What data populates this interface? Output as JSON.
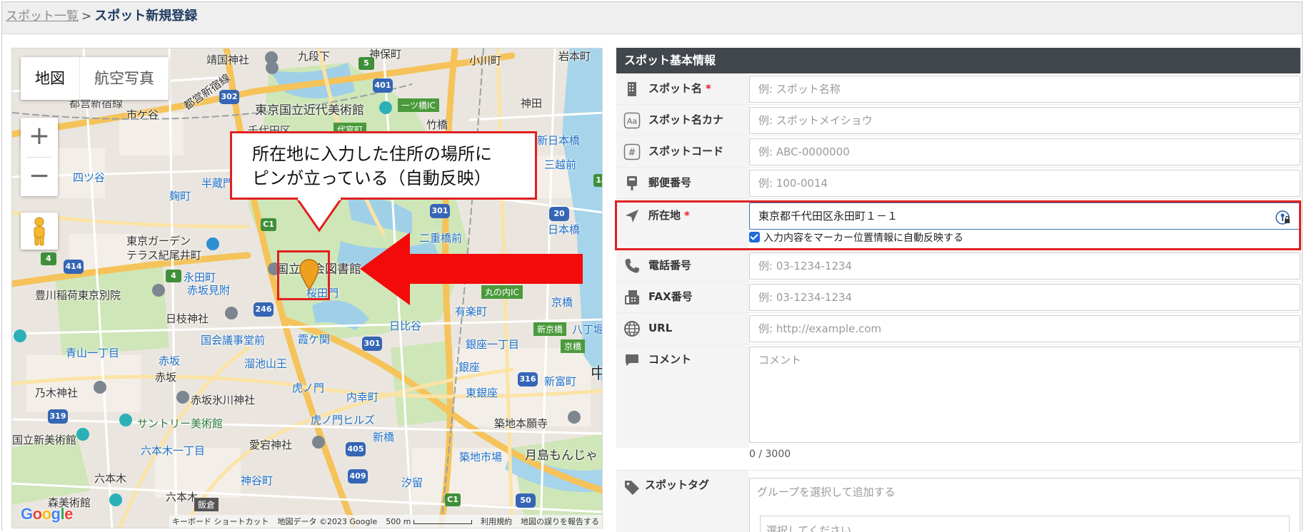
{
  "breadcrumb": {
    "parent": "スポット一覧",
    "separator": ">",
    "current": "スポット新規登録"
  },
  "map": {
    "type_tabs": [
      "地図",
      "航空写真"
    ],
    "active_tab": "地図",
    "zoom_in": "+",
    "zoom_out": "−",
    "footer": {
      "shortcuts": "キーボード ショートカット",
      "map_data": "地図データ ©2023 Google",
      "scale": "500 m",
      "terms": "利用規約",
      "report": "地図の誤りを報告する"
    },
    "callout": [
      "所在地に入力した住所の場所に",
      "ピンが立っている（自動反映）"
    ],
    "labels": {
      "yasukuni": "靖国神社",
      "kudanshita": "九段下",
      "jinbocho": "神保町",
      "ogawamachi": "小川町",
      "iwamotocho": "岩本町",
      "shinjuku_line": "都営新宿線",
      "ichigaya": "市ケ谷",
      "museum_modern_art": "東京国立近代美術館",
      "hitotsubashi": "一ツ橋IC",
      "kanda": "神田",
      "chiyoda": "千代田区",
      "daikancho": "代官町",
      "takebashi": "竹橋",
      "shinnihombashi": "新日本橋",
      "yotsuya": "四ツ谷",
      "hanzomon": "半蔵門",
      "mitsukoshimae": "三越前",
      "kojimachi": "麹町",
      "nihombashi": "日本橋",
      "nijubashimae": "二重橋前",
      "tokyo_garden_terrace": "東京ガーデン\nテラス紀尾井町",
      "national_diet_library": "国立国会図書館",
      "kyobashi_area": "京橋",
      "nagatacho": "永田町",
      "akasakamitsuke": "赤坂見附",
      "sakuradamon": "桜田門",
      "marunouchi_ic": "丸の内IC",
      "toyokawa_inari": "豊川稲荷東京別院",
      "kyobashi": "京橋",
      "hie_shrine": "日枝神社",
      "yurakucho": "有楽町",
      "hibiya": "日比谷",
      "shintomibashi": "新京橋",
      "hatchobori": "八丁堀",
      "kokkai_gijidomae": "国会議事堂前",
      "kasumigaseki": "霞ケ関",
      "ginza_itchome": "銀座一丁目",
      "kyobashi2": "京橋",
      "aoyama_itchome": "青山一丁目",
      "akasaka": "赤坂",
      "tameike_sanno": "溜池山王",
      "ginza": "銀座",
      "akasaka2": "赤坂",
      "shintomicho": "新富町",
      "nogi_shrine": "乃木神社",
      "akasaka_hikawa": "赤坂氷川神社",
      "toranomon": "虎ノ門",
      "uchisaiwaicho": "内幸町",
      "higashi_ginza": "東銀座",
      "toranomon_hills": "虎ノ門ヒルズ",
      "suntory_museum": "サントリー美術館",
      "shimbashi": "新橋",
      "tsukiji_honganji": "築地本願寺",
      "atago_shrine": "愛宕神社",
      "national_art_center": "国立新美術館",
      "roppongi_itchome": "六本木一丁目",
      "tsukiji_market": "築地市場",
      "tsukishima_monja": "月島もんじゃ",
      "roppongi": "六本木",
      "kamiyacho": "神谷町",
      "shiodome": "汐留",
      "mori_art_museum": "森美術館",
      "roppongi2": "六本木",
      "iikura": "飯倉",
      "chuo_side": "中",
      "hama": "都"
    }
  },
  "form": {
    "section_title": "スポット基本情報",
    "fields": [
      {
        "label": "スポット名",
        "required": true,
        "icon": "building-icon",
        "value": "",
        "placeholder": "例: スポット名称"
      },
      {
        "label": "スポット名カナ",
        "required": false,
        "icon": "kana-icon",
        "value": "",
        "placeholder": "例: スポットメイショウ"
      },
      {
        "label": "スポットコード",
        "required": false,
        "icon": "hash-icon",
        "value": "",
        "placeholder": "例: ABC-0000000"
      },
      {
        "label": "郵便番号",
        "required": false,
        "icon": "postbox-icon",
        "value": "",
        "placeholder": "例: 100-0014"
      },
      {
        "label": "所在地",
        "required": true,
        "icon": "location-arrow-icon",
        "value": "東京都千代田区永田町１－１",
        "placeholder": ""
      },
      {
        "label": "電話番号",
        "required": false,
        "icon": "phone-icon",
        "value": "",
        "placeholder": "例: 03-1234-1234"
      },
      {
        "label": "FAX番号",
        "required": false,
        "icon": "fax-icon",
        "value": "",
        "placeholder": "例: 03-1234-1234"
      },
      {
        "label": "URL",
        "required": false,
        "icon": "globe-icon",
        "value": "",
        "placeholder": "例: http://example.com"
      },
      {
        "label": "コメント",
        "required": false,
        "icon": "comment-icon",
        "value": "",
        "placeholder": "コメント"
      }
    ],
    "required_mark": "*",
    "address_checkbox": {
      "label": "入力内容をマーカー位置情報に自動反映する",
      "checked": true
    },
    "comment_counter": "0 / 3000",
    "tag": {
      "label": "スポットタグ",
      "group_placeholder": "グループを選択して追加する",
      "select_placeholder": "選択してください"
    }
  },
  "colors": {
    "header_bg": "#efefef",
    "section_head_bg": "#42474d",
    "highlight_red": "#e02020",
    "focus_blue": "#3d6fb3",
    "pin_orange": "#f0a020"
  }
}
